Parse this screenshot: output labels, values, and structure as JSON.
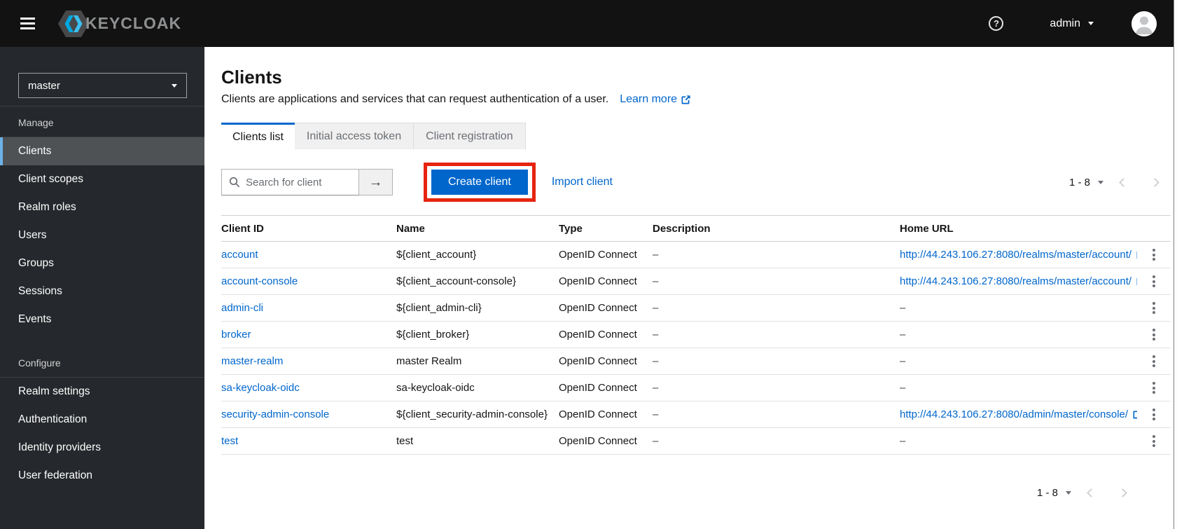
{
  "colors": {
    "primary_blue": "#0066cc",
    "annotation_red": "#e6240f",
    "nav_active_indicator": "#6cb2e8",
    "masthead_bg": "#121212",
    "sidebar_bg": "#25282c"
  },
  "masthead": {
    "brand_text": "KEYCLOAK",
    "help_glyph": "?",
    "username": "admin"
  },
  "sidebar": {
    "realm_selector": {
      "value": "master"
    },
    "groups": [
      {
        "label": "Manage",
        "items": [
          {
            "label": "Clients",
            "active": true
          },
          {
            "label": "Client scopes",
            "active": false
          },
          {
            "label": "Realm roles",
            "active": false
          },
          {
            "label": "Users",
            "active": false
          },
          {
            "label": "Groups",
            "active": false
          },
          {
            "label": "Sessions",
            "active": false
          },
          {
            "label": "Events",
            "active": false
          }
        ]
      },
      {
        "label": "Configure",
        "items": [
          {
            "label": "Realm settings",
            "active": false
          },
          {
            "label": "Authentication",
            "active": false
          },
          {
            "label": "Identity providers",
            "active": false
          },
          {
            "label": "User federation",
            "active": false
          }
        ]
      }
    ]
  },
  "page": {
    "title": "Clients",
    "description": "Clients are applications and services that can request authentication of a user.",
    "learn_more_label": "Learn more",
    "tabs": [
      {
        "label": "Clients list",
        "active": true
      },
      {
        "label": "Initial access token",
        "active": false
      },
      {
        "label": "Client registration",
        "active": false
      }
    ],
    "toolbar": {
      "search_placeholder": "Search for client",
      "search_value": "",
      "create_button_label": "Create client",
      "import_link_label": "Import client",
      "pagination_range": "1 - 8"
    },
    "table": {
      "columns": [
        "Client ID",
        "Name",
        "Type",
        "Description",
        "Home URL"
      ],
      "rows": [
        {
          "client_id": "account",
          "name": "${client_account}",
          "type": "OpenID Connect",
          "description": "–",
          "home_url": "http://44.243.106.27:8080/realms/master/account/",
          "home_url_link": true
        },
        {
          "client_id": "account-console",
          "name": "${client_account-console}",
          "type": "OpenID Connect",
          "description": "–",
          "home_url": "http://44.243.106.27:8080/realms/master/account/",
          "home_url_link": true
        },
        {
          "client_id": "admin-cli",
          "name": "${client_admin-cli}",
          "type": "OpenID Connect",
          "description": "–",
          "home_url": "–",
          "home_url_link": false
        },
        {
          "client_id": "broker",
          "name": "${client_broker}",
          "type": "OpenID Connect",
          "description": "–",
          "home_url": "–",
          "home_url_link": false
        },
        {
          "client_id": "master-realm",
          "name": "master Realm",
          "type": "OpenID Connect",
          "description": "–",
          "home_url": "–",
          "home_url_link": false
        },
        {
          "client_id": "sa-keycloak-oidc",
          "name": "sa-keycloak-oidc",
          "type": "OpenID Connect",
          "description": "–",
          "home_url": "–",
          "home_url_link": false
        },
        {
          "client_id": "security-admin-console",
          "name": "${client_security-admin-console}",
          "type": "OpenID Connect",
          "description": "–",
          "home_url": "http://44.243.106.27:8080/admin/master/console/",
          "home_url_link": true
        },
        {
          "client_id": "test",
          "name": "test",
          "type": "OpenID Connect",
          "description": "–",
          "home_url": "–",
          "home_url_link": false
        }
      ]
    },
    "pagination_bottom_range": "1 - 8"
  }
}
